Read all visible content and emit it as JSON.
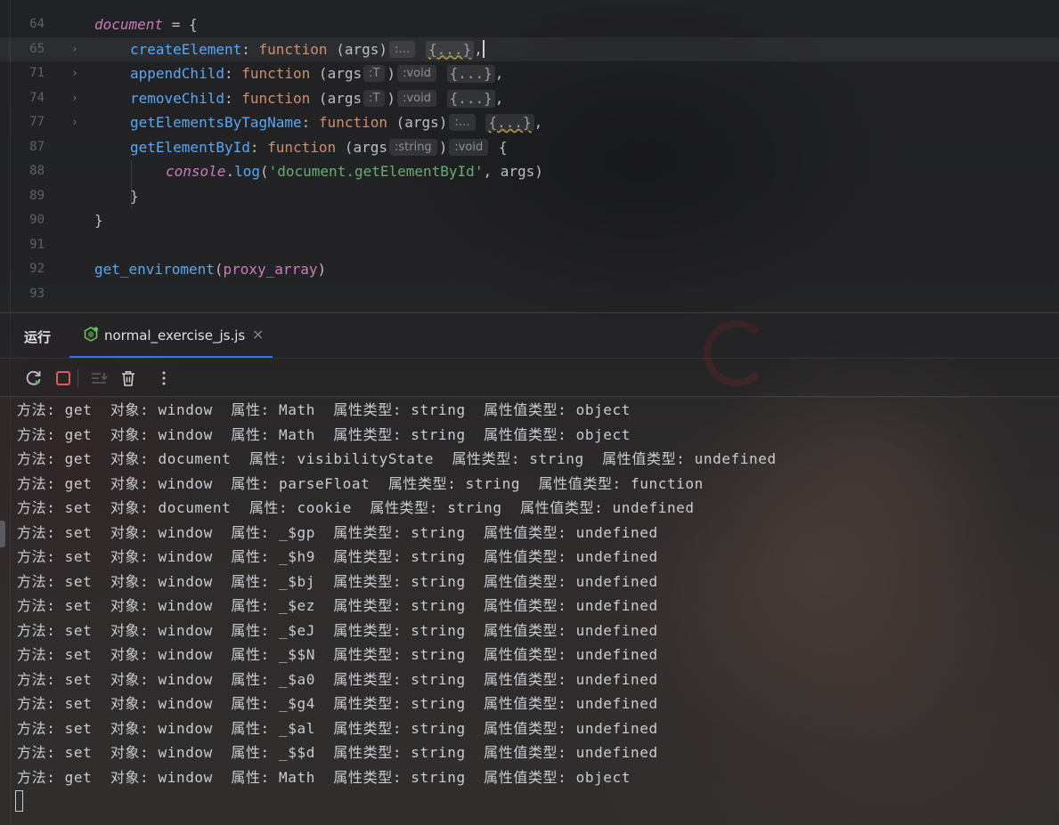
{
  "editor": {
    "lines": [
      {
        "num": "64",
        "fold": false,
        "current": false,
        "segments": [
          {
            "t": "document",
            "c": "t-id"
          },
          {
            "t": " = ",
            "c": "t-text"
          },
          {
            "t": "{",
            "c": "t-text"
          }
        ],
        "indent": 106
      },
      {
        "num": "65",
        "fold": true,
        "current": true,
        "segments": [
          {
            "t": "createElement",
            "c": "t-prop"
          },
          {
            "t": ": ",
            "c": "t-text"
          },
          {
            "t": "function",
            "c": "t-kw"
          },
          {
            "t": " (args)",
            "c": "t-text"
          },
          {
            "hint": ":…"
          },
          {
            "t": " ",
            "c": "t-text"
          },
          {
            "block": "{...}",
            "wavy": true
          },
          {
            "t": ",",
            "c": "t-text"
          },
          {
            "caret": true
          }
        ],
        "indent": 146
      },
      {
        "num": "71",
        "fold": true,
        "current": false,
        "segments": [
          {
            "t": "appendChild",
            "c": "t-prop"
          },
          {
            "t": ": ",
            "c": "t-text"
          },
          {
            "t": "function",
            "c": "t-kw"
          },
          {
            "t": " (args",
            "c": "t-text"
          },
          {
            "hint": ":T"
          },
          {
            "t": ")",
            "c": "t-text"
          },
          {
            "hint": ":void"
          },
          {
            "t": " ",
            "c": "t-text"
          },
          {
            "block": "{...}"
          },
          {
            "t": ",",
            "c": "t-text"
          }
        ],
        "indent": 146
      },
      {
        "num": "74",
        "fold": true,
        "current": false,
        "segments": [
          {
            "t": "removeChild",
            "c": "t-prop"
          },
          {
            "t": ": ",
            "c": "t-text"
          },
          {
            "t": "function",
            "c": "t-kw"
          },
          {
            "t": " (args",
            "c": "t-text"
          },
          {
            "hint": ":T"
          },
          {
            "t": ")",
            "c": "t-text"
          },
          {
            "hint": ":void"
          },
          {
            "t": " ",
            "c": "t-text"
          },
          {
            "block": "{...}"
          },
          {
            "t": ",",
            "c": "t-text"
          }
        ],
        "indent": 146
      },
      {
        "num": "77",
        "fold": true,
        "current": false,
        "segments": [
          {
            "t": "getElementsByTagName",
            "c": "t-prop"
          },
          {
            "t": ": ",
            "c": "t-text"
          },
          {
            "t": "function",
            "c": "t-kw"
          },
          {
            "t": " (args)",
            "c": "t-text"
          },
          {
            "hint": ":…"
          },
          {
            "t": " ",
            "c": "t-text"
          },
          {
            "block": "{...}",
            "wavy": true
          },
          {
            "t": ",",
            "c": "t-text"
          }
        ],
        "indent": 146
      },
      {
        "num": "87",
        "fold": false,
        "current": false,
        "segments": [
          {
            "t": "getElementById",
            "c": "t-prop"
          },
          {
            "t": ": ",
            "c": "t-text"
          },
          {
            "t": "function",
            "c": "t-kw"
          },
          {
            "t": " (args",
            "c": "t-text"
          },
          {
            "hint": ":string"
          },
          {
            "t": ")",
            "c": "t-text"
          },
          {
            "hint": ":void"
          },
          {
            "t": " {",
            "c": "t-text"
          }
        ],
        "indent": 146
      },
      {
        "num": "88",
        "fold": false,
        "current": false,
        "segments": [
          {
            "t": "console",
            "c": "t-id"
          },
          {
            "t": ".",
            "c": "t-text"
          },
          {
            "t": "log",
            "c": "t-fn"
          },
          {
            "t": "(",
            "c": "t-text"
          },
          {
            "t": "'document.getElementById'",
            "c": "t-str"
          },
          {
            "t": ", args)",
            "c": "t-text"
          }
        ],
        "indent": 186
      },
      {
        "num": "89",
        "fold": false,
        "current": false,
        "segments": [
          {
            "t": "}",
            "c": "t-text"
          }
        ],
        "indent": 146
      },
      {
        "num": "90",
        "fold": false,
        "current": false,
        "segments": [
          {
            "t": "}",
            "c": "t-text"
          }
        ],
        "indent": 106
      },
      {
        "num": "91",
        "fold": false,
        "current": false,
        "segments": [],
        "indent": 106
      },
      {
        "num": "92",
        "fold": false,
        "current": false,
        "segments": [
          {
            "t": "get_enviroment",
            "c": "t-fn"
          },
          {
            "t": "(",
            "c": "t-text"
          },
          {
            "t": "proxy_array",
            "c": "t-pub"
          },
          {
            "t": ")",
            "c": "t-text"
          }
        ],
        "indent": 106
      },
      {
        "num": "93",
        "fold": false,
        "current": false,
        "segments": [],
        "indent": 106
      }
    ]
  },
  "run_panel": {
    "title": "运行",
    "tab_label": "normal_exercise_js.js",
    "tab_close": "×",
    "toolbar": {
      "rerun_icon": "rerun-icon",
      "stop_icon": "stop-icon",
      "scroll_icon": "scroll-to-end-icon",
      "clear_icon": "trash-icon",
      "more_icon": "more-vertical-icon"
    }
  },
  "console": {
    "lines": [
      "方法: get  对象: window  属性: Math  属性类型: string  属性值类型: object",
      "方法: get  对象: window  属性: Math  属性类型: string  属性值类型: object",
      "方法: get  对象: document  属性: visibilityState  属性类型: string  属性值类型: undefined",
      "方法: get  对象: window  属性: parseFloat  属性类型: string  属性值类型: function",
      "方法: set  对象: document  属性: cookie  属性类型: string  属性值类型: undefined",
      "方法: set  对象: window  属性: _$gp  属性类型: string  属性值类型: undefined",
      "方法: set  对象: window  属性: _$h9  属性类型: string  属性值类型: undefined",
      "方法: set  对象: window  属性: _$bj  属性类型: string  属性值类型: undefined",
      "方法: set  对象: window  属性: _$ez  属性类型: string  属性值类型: undefined",
      "方法: set  对象: window  属性: _$eJ  属性类型: string  属性值类型: undefined",
      "方法: set  对象: window  属性: _$$N  属性类型: string  属性值类型: undefined",
      "方法: set  对象: window  属性: _$a0  属性类型: string  属性值类型: undefined",
      "方法: set  对象: window  属性: _$g4  属性类型: string  属性值类型: undefined",
      "方法: set  对象: window  属性: _$al  属性类型: string  属性值类型: undefined",
      "方法: set  对象: window  属性: _$$d  属性类型: string  属性值类型: undefined",
      "方法: get  对象: window  属性: Math  属性类型: string  属性值类型: object"
    ]
  },
  "colors": {
    "accent": "#3574f0",
    "stop": "#db5c5c",
    "rerun_badge": "#5fb865"
  }
}
